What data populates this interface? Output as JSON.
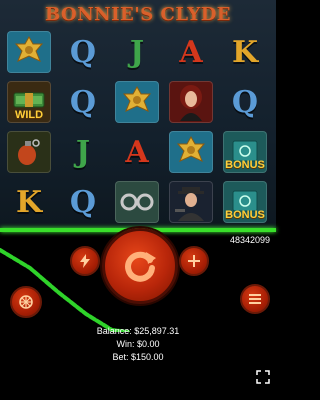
{
  "game": {
    "title": "BONNIE'S CLYDE",
    "game_id": "48342099"
  },
  "reels": {
    "rows": [
      [
        {
          "kind": "tile",
          "icon": "sheriff-badge-icon",
          "label": "",
          "bg": "#1f6f8a"
        },
        {
          "kind": "letter",
          "text": "Q",
          "color": "#5b9bd6"
        },
        {
          "kind": "letter",
          "text": "J",
          "color": "#3fa54a"
        },
        {
          "kind": "letter",
          "text": "A",
          "color": "#d5371c"
        },
        {
          "kind": "letter",
          "text": "K",
          "color": "#e3a62a"
        }
      ],
      [
        {
          "kind": "tile",
          "icon": "money-stack-icon",
          "label": "WILD",
          "bg": "#3a2a12"
        },
        {
          "kind": "letter",
          "text": "Q",
          "color": "#5b9bd6"
        },
        {
          "kind": "tile",
          "icon": "sheriff-badge-icon",
          "label": "",
          "bg": "#1f6f8a"
        },
        {
          "kind": "tile",
          "icon": "woman-portrait-icon",
          "label": "",
          "bg": "#5a1410"
        },
        {
          "kind": "letter",
          "text": "Q",
          "color": "#5b9bd6"
        }
      ],
      [
        {
          "kind": "tile",
          "icon": "grenade-icon",
          "label": "",
          "bg": "#2a3018"
        },
        {
          "kind": "letter",
          "text": "J",
          "color": "#3fa54a"
        },
        {
          "kind": "letter",
          "text": "A",
          "color": "#d5371c"
        },
        {
          "kind": "tile",
          "icon": "sheriff-badge-icon",
          "label": "",
          "bg": "#1f6f8a"
        },
        {
          "kind": "tile",
          "icon": "safe-icon",
          "label": "BONUS",
          "bg": "#1d5a5a"
        }
      ],
      [
        {
          "kind": "letter",
          "text": "K",
          "color": "#e3a62a"
        },
        {
          "kind": "letter",
          "text": "Q",
          "color": "#5b9bd6"
        },
        {
          "kind": "tile",
          "icon": "handcuffs-icon",
          "label": "",
          "bg": "#2c4a40"
        },
        {
          "kind": "tile",
          "icon": "gangster-icon",
          "label": "",
          "bg": "#1a2230"
        },
        {
          "kind": "tile",
          "icon": "safe-icon",
          "label": "BONUS",
          "bg": "#1d5a5a"
        }
      ]
    ]
  },
  "status": {
    "balance": "Balance: $25,897.31",
    "win": "Win: $0.00",
    "bet": "Bet: $150.00"
  },
  "colors": {
    "payline": "#39e02a",
    "button_red": "#c8300c",
    "title_orange": "#d9602b"
  },
  "controls": {
    "icons": [
      "lightning-icon",
      "spin-icon",
      "plus-icon",
      "wheel-icon",
      "menu-icon",
      "fullscreen-icon"
    ]
  }
}
